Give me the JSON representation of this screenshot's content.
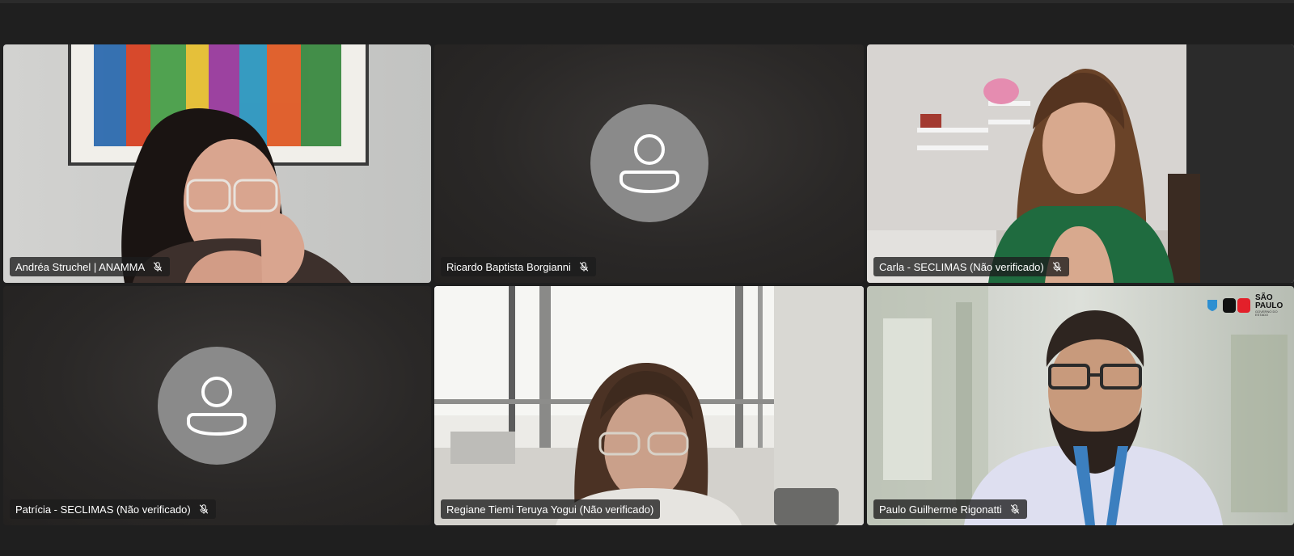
{
  "meeting": {
    "participants": [
      {
        "name": "Andréa Struchel | ANAMMA",
        "muted": true,
        "video": true
      },
      {
        "name": "Ricardo Baptista Borgianni",
        "muted": true,
        "video": false
      },
      {
        "name": "Carla - SECLIMAS (Não verificado)",
        "muted": true,
        "video": true
      },
      {
        "name": "Patrícia - SECLIMAS (Não verificado)",
        "muted": true,
        "video": false
      },
      {
        "name": "Regiane Tiemi Teruya Yogui (Não verificado)",
        "muted": false,
        "video": true,
        "speaking": true
      },
      {
        "name": "Paulo Guilherme Rigonatti",
        "muted": true,
        "video": true
      }
    ],
    "logo_text": "SÃO PAULO",
    "logo_subtext": "GOVERNO DO ESTADO",
    "colors": {
      "background": "#1f1f1f",
      "active_border": "#7f85f5",
      "avatar": "#8a8a8a"
    },
    "icons": {
      "muted": "mic-off-icon",
      "avatar": "person-icon"
    }
  }
}
